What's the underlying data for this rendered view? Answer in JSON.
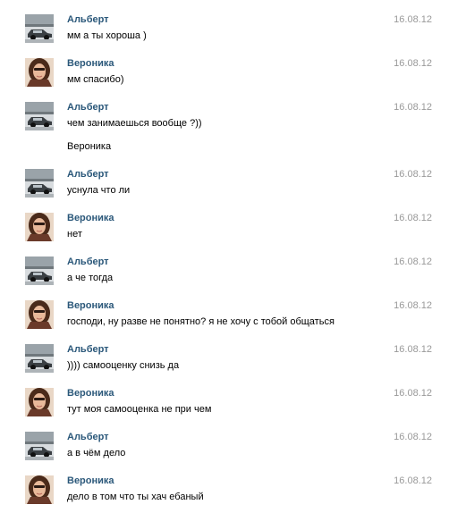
{
  "messages": [
    {
      "author": "Альберт",
      "avatar": "car-avatar",
      "date": "16.08.12",
      "text": "мм а ты хороша )"
    },
    {
      "author": "Вероника",
      "avatar": "girl-avatar",
      "date": "16.08.12",
      "text": "мм спасибо)"
    },
    {
      "author": "Альберт",
      "avatar": "car-avatar",
      "date": "16.08.12",
      "text": "чем занимаешься вообще ?))"
    },
    {
      "author": "Альберт",
      "avatar": "car-avatar",
      "date": "16.08.12",
      "text": "уснула что ли"
    },
    {
      "author": "Вероника",
      "avatar": "girl-avatar",
      "date": "16.08.12",
      "text": "нет"
    },
    {
      "author": "Альберт",
      "avatar": "car-avatar",
      "date": "16.08.12",
      "text": "а че тогда"
    },
    {
      "author": "Вероника",
      "avatar": "girl-avatar",
      "date": "16.08.12",
      "text": "господи, ну разве не понятно? я не хочу с тобой общаться"
    },
    {
      "author": "Альберт",
      "avatar": "car-avatar",
      "date": "16.08.12",
      "text": ")))) самооценку снизь да"
    },
    {
      "author": "Вероника",
      "avatar": "girl-avatar",
      "date": "16.08.12",
      "text": "тут моя самооценка не при чем"
    },
    {
      "author": "Альберт",
      "avatar": "car-avatar",
      "date": "16.08.12",
      "text": "а в чём дело"
    },
    {
      "author": "Вероника",
      "avatar": "girl-avatar",
      "date": "16.08.12",
      "text": "дело в том что ты хач ебаный"
    }
  ],
  "standalone_name": "Вероника",
  "colors": {
    "author": "#2b587a",
    "date": "#999999",
    "text": "#000000",
    "background": "#ffffff"
  }
}
